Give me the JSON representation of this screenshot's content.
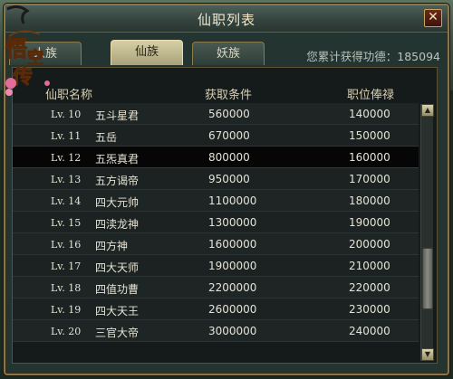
{
  "window": {
    "title": "仙职列表",
    "close_label": "✕"
  },
  "logo": {
    "text": "悟空传"
  },
  "tabs": [
    {
      "label": "人族",
      "active": false
    },
    {
      "label": "仙族",
      "active": true
    },
    {
      "label": "妖族",
      "active": false
    }
  ],
  "merit": {
    "label": "您累计获得功德：",
    "value": "185094"
  },
  "table": {
    "headers": {
      "name": "仙职名称",
      "condition": "获取条件",
      "salary": "职位俸禄"
    },
    "rows": [
      {
        "level": "Lv. 10",
        "name": "五斗星君",
        "condition": "560000",
        "salary": "140000",
        "selected": false
      },
      {
        "level": "Lv. 11",
        "name": "五岳",
        "condition": "670000",
        "salary": "150000",
        "selected": false
      },
      {
        "level": "Lv. 12",
        "name": "五炁真君",
        "condition": "800000",
        "salary": "160000",
        "selected": true
      },
      {
        "level": "Lv. 13",
        "name": "五方谒帝",
        "condition": "950000",
        "salary": "170000",
        "selected": false
      },
      {
        "level": "Lv. 14",
        "name": "四大元帅",
        "condition": "1100000",
        "salary": "180000",
        "selected": false
      },
      {
        "level": "Lv. 15",
        "name": "四渎龙神",
        "condition": "1300000",
        "salary": "190000",
        "selected": false
      },
      {
        "level": "Lv. 16",
        "name": "四方神",
        "condition": "1600000",
        "salary": "200000",
        "selected": false
      },
      {
        "level": "Lv. 17",
        "name": "四大天师",
        "condition": "1900000",
        "salary": "210000",
        "selected": false
      },
      {
        "level": "Lv. 18",
        "name": "四值功曹",
        "condition": "2200000",
        "salary": "220000",
        "selected": false
      },
      {
        "level": "Lv. 19",
        "name": "四大天王",
        "condition": "2600000",
        "salary": "230000",
        "selected": false
      },
      {
        "level": "Lv. 20",
        "name": "三官大帝",
        "condition": "3000000",
        "salary": "240000",
        "selected": false
      }
    ]
  },
  "scrollbar": {
    "up_icon": "▲",
    "down_icon": "▼",
    "position_fraction": 0.78
  }
}
